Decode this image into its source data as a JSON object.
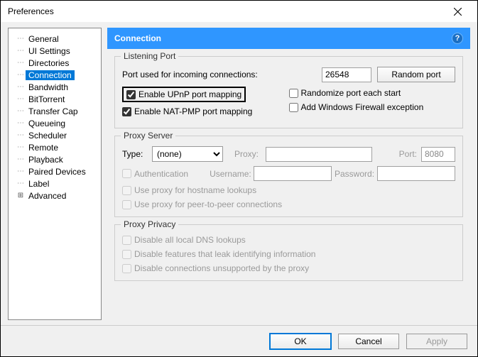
{
  "window": {
    "title": "Preferences"
  },
  "tree": {
    "items": [
      "General",
      "UI Settings",
      "Directories",
      "Connection",
      "Bandwidth",
      "BitTorrent",
      "Transfer Cap",
      "Queueing",
      "Scheduler",
      "Remote",
      "Playback",
      "Paired Devices",
      "Label",
      "Advanced"
    ],
    "selected_index": 3,
    "expandable_index": 13
  },
  "panel": {
    "title": "Connection"
  },
  "listening_port": {
    "legend": "Listening Port",
    "port_label": "Port used for incoming connections:",
    "port_value": "26548",
    "random_button": "Random port",
    "upnp_label": "Enable UPnP port mapping",
    "upnp_checked": true,
    "natpmp_label": "Enable NAT-PMP port mapping",
    "natpmp_checked": true,
    "randomize_label": "Randomize port each start",
    "randomize_checked": false,
    "firewall_label": "Add Windows Firewall exception",
    "firewall_checked": false
  },
  "proxy_server": {
    "legend": "Proxy Server",
    "type_label": "Type:",
    "type_value": "(none)",
    "proxy_label": "Proxy:",
    "port_label": "Port:",
    "port_value": "8080",
    "auth_label": "Authentication",
    "username_label": "Username:",
    "password_label": "Password:",
    "hostname_label": "Use proxy for hostname lookups",
    "p2p_label": "Use proxy for peer-to-peer connections"
  },
  "proxy_privacy": {
    "legend": "Proxy Privacy",
    "dns_label": "Disable all local DNS lookups",
    "leak_label": "Disable features that leak identifying information",
    "unsupported_label": "Disable connections unsupported by the proxy"
  },
  "buttons": {
    "ok": "OK",
    "cancel": "Cancel",
    "apply": "Apply"
  }
}
